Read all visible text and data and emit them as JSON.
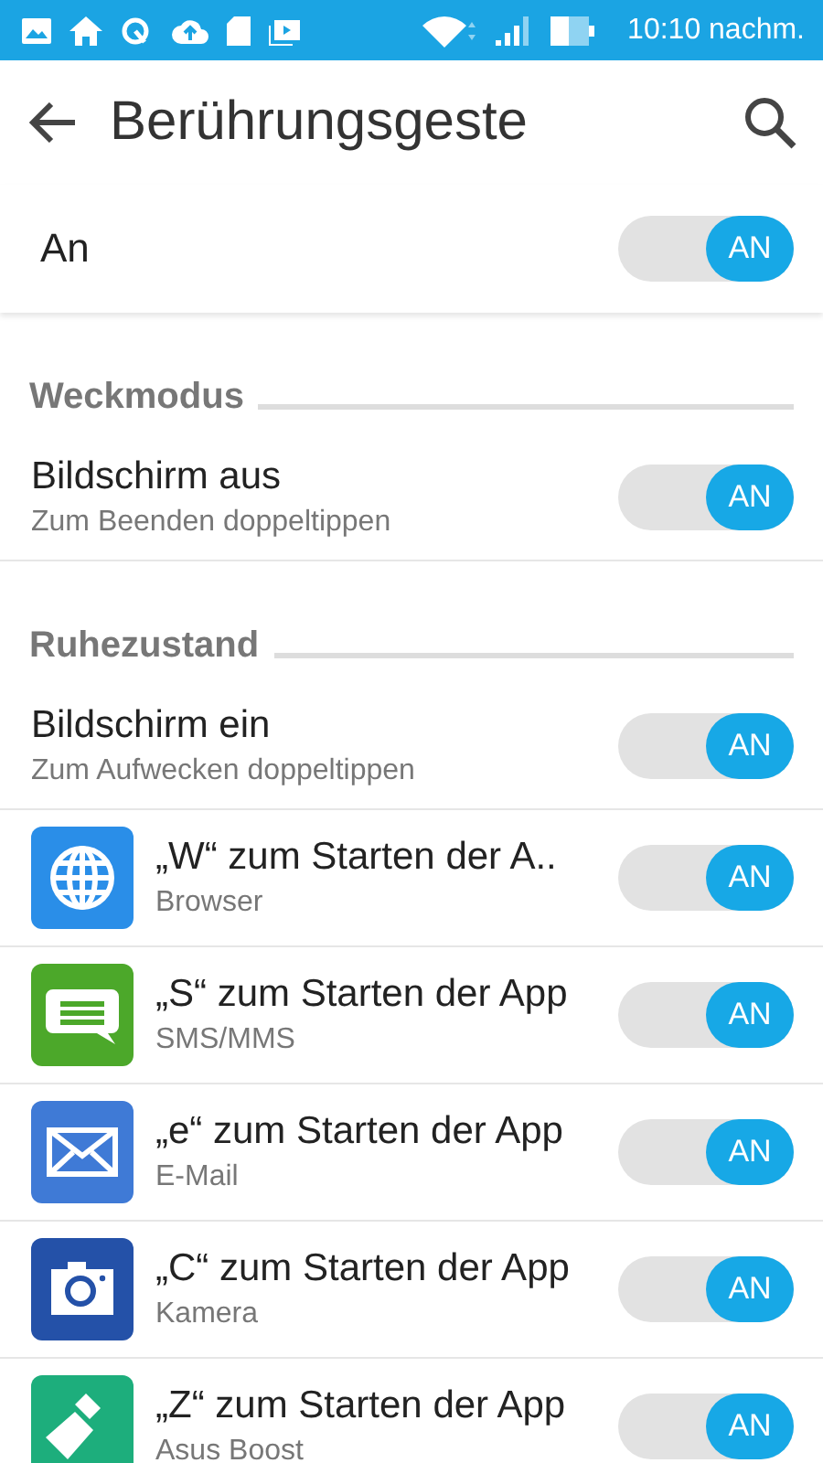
{
  "status_bar": {
    "time": "10:10 nachm."
  },
  "header": {
    "title": "Berührungsgeste"
  },
  "master": {
    "label": "An",
    "toggle": {
      "text": "AN",
      "on": true
    }
  },
  "sections": [
    {
      "title": "Weckmodus",
      "items": [
        {
          "kind": "plain",
          "title": "Bildschirm aus",
          "subtitle": "Zum Beenden doppeltippen",
          "toggle": {
            "text": "AN",
            "on": true
          }
        }
      ]
    },
    {
      "title": "Ruhezustand",
      "items": [
        {
          "kind": "plain",
          "title": "Bildschirm ein",
          "subtitle": "Zum Aufwecken doppeltippen",
          "toggle": {
            "text": "AN",
            "on": true
          }
        },
        {
          "kind": "browser",
          "title": "„W“ zum Starten der A..",
          "subtitle": "Browser",
          "toggle": {
            "text": "AN",
            "on": true
          }
        },
        {
          "kind": "sms",
          "title": "„S“ zum Starten der App",
          "subtitle": "SMS/MMS",
          "toggle": {
            "text": "AN",
            "on": true
          }
        },
        {
          "kind": "email",
          "title": "„e“ zum Starten der App",
          "subtitle": "E-Mail",
          "toggle": {
            "text": "AN",
            "on": true
          }
        },
        {
          "kind": "camera",
          "title": "„C“ zum Starten der App",
          "subtitle": "Kamera",
          "toggle": {
            "text": "AN",
            "on": true
          }
        },
        {
          "kind": "boost",
          "title": "„Z“ zum Starten der App",
          "subtitle": "Asus Boost",
          "toggle": {
            "text": "AN",
            "on": true
          }
        }
      ]
    }
  ]
}
